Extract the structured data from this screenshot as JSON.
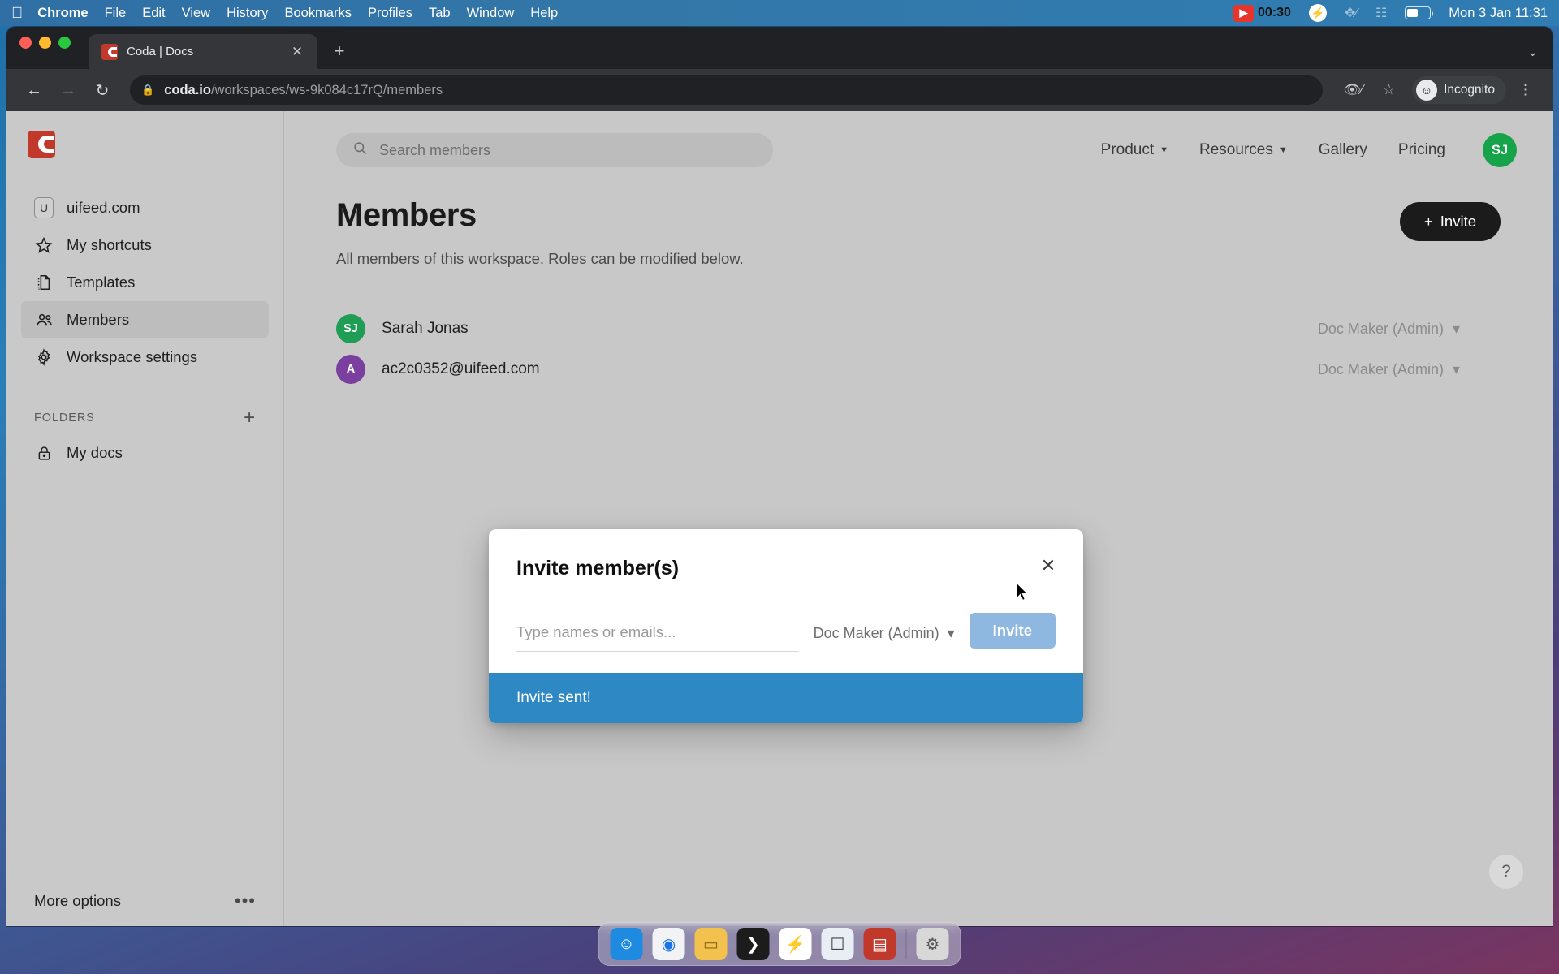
{
  "menubar": {
    "apple_icon": "apple-icon",
    "items": [
      {
        "label": "Chrome",
        "bold": true
      },
      {
        "label": "File",
        "bold": false
      },
      {
        "label": "Edit",
        "bold": false
      },
      {
        "label": "View",
        "bold": false
      },
      {
        "label": "History",
        "bold": false
      },
      {
        "label": "Bookmarks",
        "bold": false
      },
      {
        "label": "Profiles",
        "bold": false
      },
      {
        "label": "Tab",
        "bold": false
      },
      {
        "label": "Window",
        "bold": false
      },
      {
        "label": "Help",
        "bold": false
      }
    ],
    "screen_record_time": "00:30",
    "clock": "Mon 3 Jan  11:31",
    "status_icons": [
      "screen-record-icon",
      "bolt-icon",
      "bluetooth-off-icon",
      "control-center-icon",
      "battery-icon"
    ]
  },
  "browser": {
    "tab": {
      "title": "Coda | Docs",
      "favicon": "coda-favicon",
      "close_label": "✕"
    },
    "new_tab_label": "+",
    "tabstrip_menu_label": "⌄",
    "toolbar": {
      "back_label": "←",
      "forward_label": "→",
      "reload_label": "↻",
      "lock_label": "🔒",
      "url_host": "coda.io",
      "url_path": "/workspaces/ws-9k084c17rQ/members",
      "third_party_cookie_icon": "eye-slash-icon",
      "bookmark_icon": "star-icon",
      "menu_icon": "kebab-menu-icon",
      "incognito_label": "Incognito",
      "incognito_avatar_icon": "incognito-hat-icon"
    }
  },
  "sidebar": {
    "logo": "coda-logo",
    "workspace": {
      "badge": "U",
      "label": "uifeed.com"
    },
    "items": [
      {
        "label": "My shortcuts",
        "icon": "star-icon",
        "active": false
      },
      {
        "label": "Templates",
        "icon": "templates-icon",
        "active": false
      },
      {
        "label": "Members",
        "icon": "members-icon",
        "active": true
      },
      {
        "label": "Workspace settings",
        "icon": "gear-icon",
        "active": false
      }
    ],
    "folders": {
      "heading": "FOLDERS",
      "add_label": "+",
      "items": [
        {
          "label": "My docs",
          "icon": "lock-icon"
        }
      ]
    },
    "more_options": {
      "label": "More options",
      "dots": "•••"
    }
  },
  "topnav": {
    "search_placeholder": "Search members",
    "search_icon": "search-icon",
    "links": [
      {
        "label": "Product",
        "has_caret": true
      },
      {
        "label": "Resources",
        "has_caret": true
      },
      {
        "label": "Gallery",
        "has_caret": false
      },
      {
        "label": "Pricing",
        "has_caret": false
      }
    ],
    "avatar": {
      "initials": "SJ",
      "color": "#16a34a"
    }
  },
  "main": {
    "title": "Members",
    "subtitle": "All members of this workspace. Roles can be modified below.",
    "invite_button": {
      "label": "Invite",
      "plus": "+"
    },
    "members": [
      {
        "initials": "SJ",
        "color": "#1f9d55",
        "name": "Sarah Jonas",
        "role": "Doc Maker (Admin)"
      },
      {
        "initials": "A",
        "color": "#7b3fa0",
        "name": "ac2c0352@uifeed.com",
        "role": "Doc Maker (Admin)"
      }
    ],
    "role_caret": "▾",
    "help_button": {
      "label": "?"
    }
  },
  "modal": {
    "title": "Invite member(s)",
    "close_label": "✕",
    "input_placeholder": "Type names or emails...",
    "input_value": "",
    "role_value": "Doc Maker (Admin)",
    "role_caret": "▾",
    "invite_button_label": "Invite",
    "toast_message": "Invite sent!",
    "toast_color": "#2d88c3",
    "button_color": "#8fb8e0"
  },
  "dock": {
    "items": [
      {
        "name": "finder",
        "glyph": "🙂",
        "color": "#1e8ae0"
      },
      {
        "name": "chrome",
        "glyph": "◉",
        "color": "#f1f3f4"
      },
      {
        "name": "notes",
        "glyph": "▭",
        "color": "#f2c14e"
      },
      {
        "name": "terminal",
        "glyph": "❯",
        "color": "#1c1c1c"
      },
      {
        "name": "zap-app",
        "glyph": "⚡",
        "color": "#ffffff"
      },
      {
        "name": "preview",
        "glyph": "🗎",
        "color": "#e9eef5"
      },
      {
        "name": "toolbox",
        "glyph": "▤",
        "color": "#c0392b"
      },
      {
        "name": "trash",
        "glyph": "🗑",
        "color": "#d8d8d8"
      }
    ]
  }
}
